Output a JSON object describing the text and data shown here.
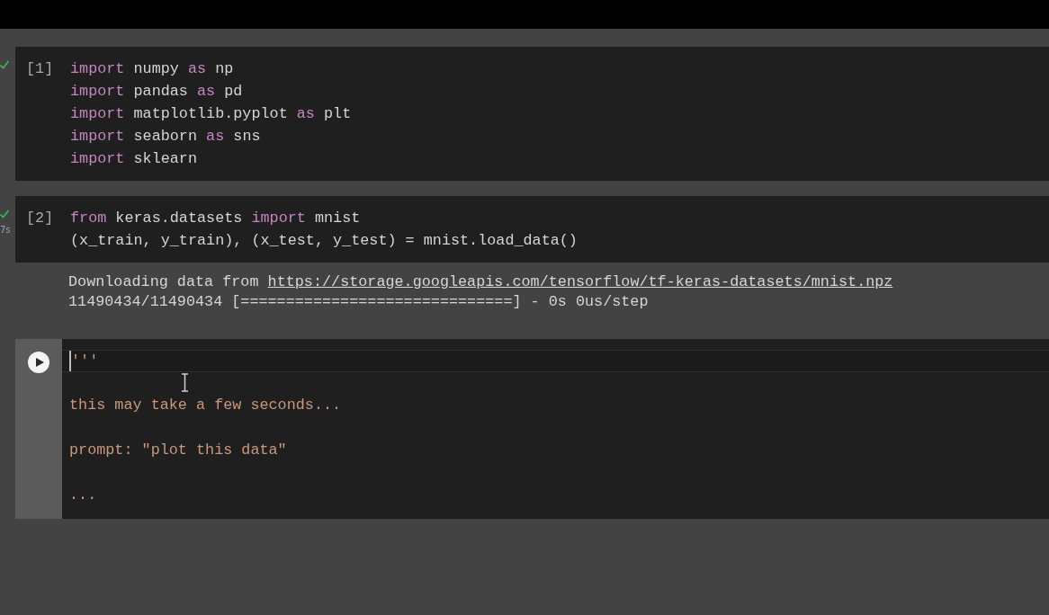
{
  "cells": [
    {
      "kind": "executed",
      "counter": "[1]",
      "succeeded": true,
      "lines": [
        {
          "tokens": [
            {
              "text": "import",
              "kind": "keyword"
            },
            {
              "text": " numpy ",
              "kind": "plain"
            },
            {
              "text": "as",
              "kind": "keyword"
            },
            {
              "text": " np",
              "kind": "plain"
            }
          ]
        },
        {
          "tokens": [
            {
              "text": "import",
              "kind": "keyword"
            },
            {
              "text": " pandas ",
              "kind": "plain"
            },
            {
              "text": "as",
              "kind": "keyword"
            },
            {
              "text": " pd",
              "kind": "plain"
            }
          ]
        },
        {
          "tokens": [
            {
              "text": "import",
              "kind": "keyword"
            },
            {
              "text": " matplotlib.pyplot ",
              "kind": "plain"
            },
            {
              "text": "as",
              "kind": "keyword"
            },
            {
              "text": " plt",
              "kind": "plain"
            }
          ]
        },
        {
          "tokens": [
            {
              "text": "import",
              "kind": "keyword"
            },
            {
              "text": " seaborn ",
              "kind": "plain"
            },
            {
              "text": "as",
              "kind": "keyword"
            },
            {
              "text": " sns",
              "kind": "plain"
            }
          ]
        },
        {
          "tokens": [
            {
              "text": "import",
              "kind": "keyword"
            },
            {
              "text": " sklearn",
              "kind": "plain"
            }
          ]
        }
      ]
    },
    {
      "kind": "executed",
      "counter": "[2]",
      "succeeded": true,
      "duration": "7s",
      "lines": [
        {
          "tokens": [
            {
              "text": "from",
              "kind": "keyword"
            },
            {
              "text": " keras.datasets ",
              "kind": "plain"
            },
            {
              "text": "import",
              "kind": "keyword"
            },
            {
              "text": " mnist",
              "kind": "plain"
            }
          ]
        },
        {
          "tokens": [
            {
              "text": "(x_train, y_train), (x_test, y_test) = mnist.load_data()",
              "kind": "plain"
            }
          ]
        }
      ],
      "output": [
        {
          "tokens": [
            {
              "text": "Downloading data from ",
              "kind": "plain"
            },
            {
              "text": "https://storage.googleapis.com/tensorflow/tf-keras-datasets/mnist.npz",
              "kind": "link"
            }
          ]
        },
        {
          "tokens": [
            {
              "text": "11490434/11490434 [==============================] - 0s 0us/step",
              "kind": "plain"
            }
          ]
        }
      ]
    },
    {
      "kind": "editing",
      "lines": [
        {
          "current": true,
          "tokens": [
            {
              "text": "'''",
              "kind": "string"
            }
          ]
        },
        {
          "current": false,
          "tokens": [
            {
              "text": "this may take a few seconds...",
              "kind": "string"
            }
          ]
        },
        {
          "current": false,
          "tokens": [
            {
              "text": "prompt: \"plot this data\"",
              "kind": "string"
            }
          ]
        },
        {
          "current": false,
          "tokens": [
            {
              "text": "...",
              "kind": "string"
            }
          ]
        }
      ]
    }
  ]
}
